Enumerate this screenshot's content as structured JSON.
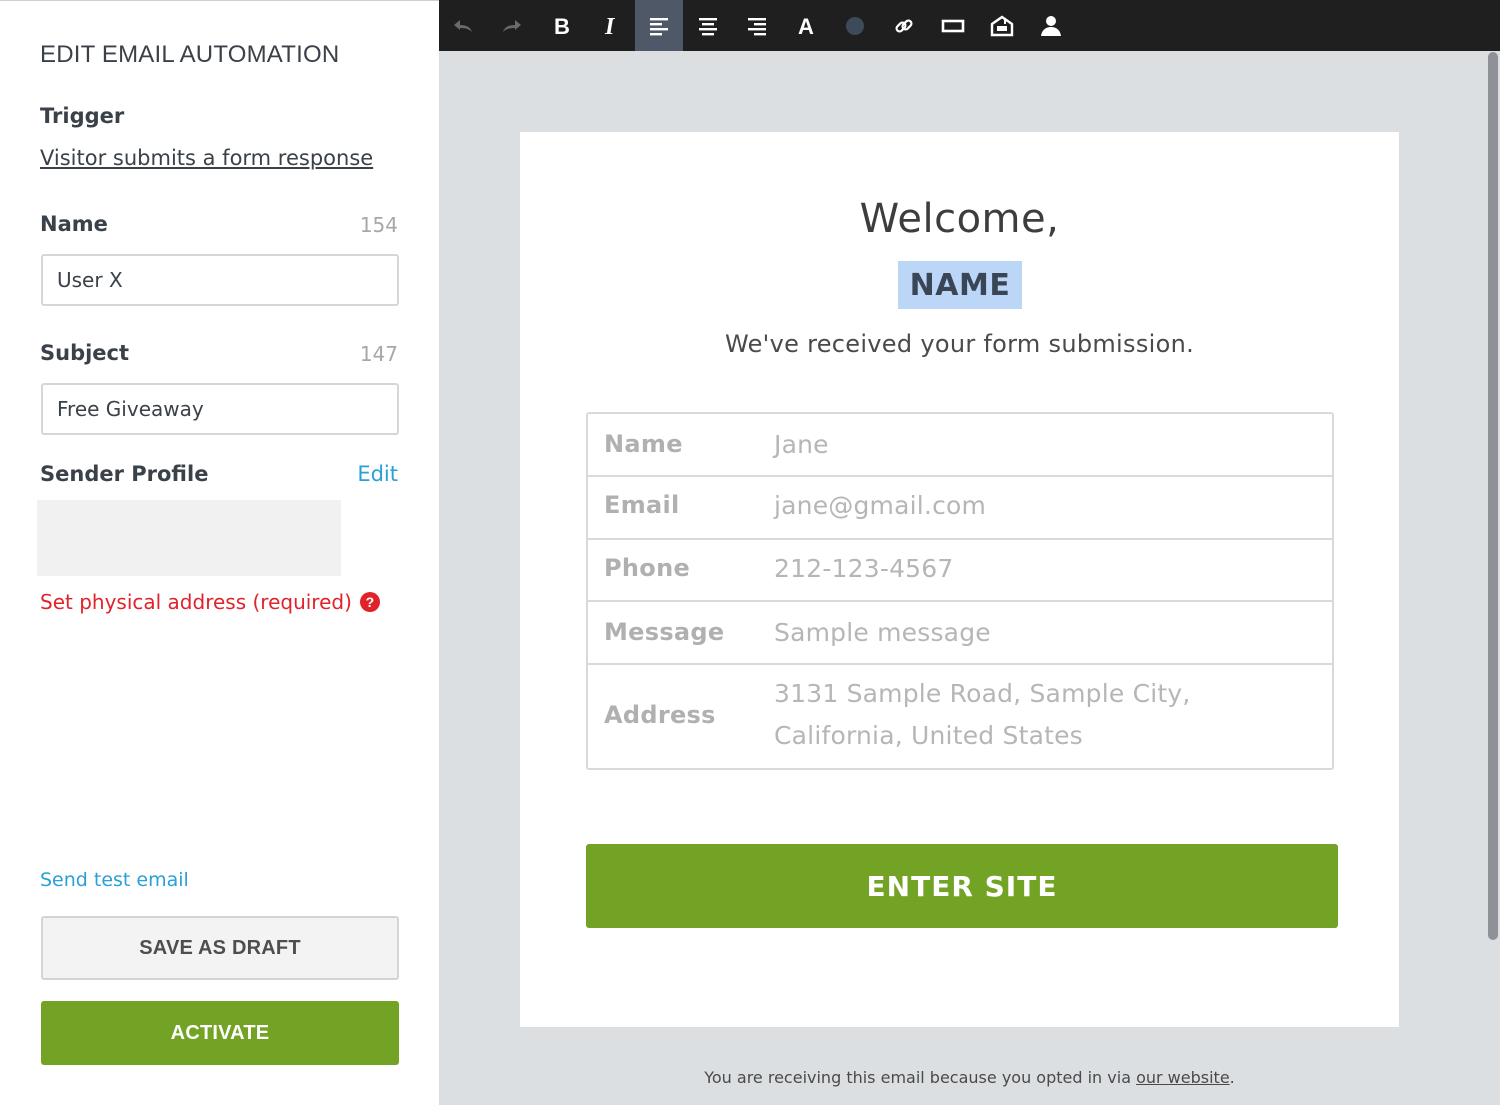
{
  "sidebar": {
    "title": "EDIT EMAIL AUTOMATION",
    "trigger_label": "Trigger",
    "trigger_value": "Visitor submits a form response",
    "name_label": "Name",
    "name_count": "154",
    "name_value": "User X",
    "subject_label": "Subject",
    "subject_count": "147",
    "subject_value": "Free Giveaway",
    "sender_label": "Sender Profile",
    "sender_edit": "Edit",
    "address_warning": "Set physical address (required)",
    "send_test": "Send test email",
    "save_draft": "SAVE AS DRAFT",
    "activate": "ACTIVATE"
  },
  "toolbar": {
    "items": [
      "undo-icon",
      "redo-icon",
      "bold-icon",
      "italic-icon",
      "align-left-icon",
      "align-center-icon",
      "align-right-icon",
      "font-color-icon",
      "background-color-icon",
      "link-icon",
      "button-icon",
      "mailbox-icon",
      "person-icon"
    ],
    "active": "align-left-icon"
  },
  "email": {
    "heading": "Welcome,",
    "name_tag": "NAME",
    "subheading": "We've received your form submission.",
    "fields": [
      {
        "key": "Name",
        "value": "Jane"
      },
      {
        "key": "Email",
        "value": "jane@gmail.com"
      },
      {
        "key": "Phone",
        "value": "212-123-4567"
      },
      {
        "key": "Message",
        "value": "Sample message"
      },
      {
        "key": "Address",
        "value": "3131 Sample Road, Sample City,",
        "value2": "California, United States"
      }
    ],
    "cta": "ENTER SITE",
    "footer_text": "You are receiving this email because you opted in via ",
    "footer_link": "our website",
    "footer_end": "."
  },
  "colors": {
    "accent_green": "#73a325",
    "link_blue": "#2a9fd8",
    "warning_red": "#e0232a",
    "toolbar_bg": "#1f1f20",
    "canvas_bg": "#dcdfe2",
    "name_highlight": "#bcd6f7"
  }
}
